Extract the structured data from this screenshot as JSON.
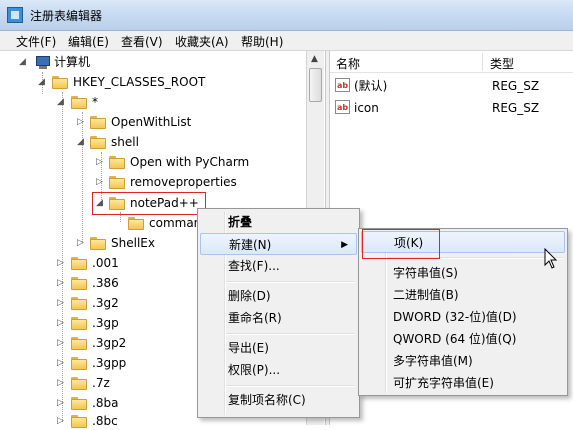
{
  "window": {
    "title": "注册表编辑器"
  },
  "menubar": [
    "文件(F)",
    "编辑(E)",
    "查看(V)",
    "收藏夹(A)",
    "帮助(H)"
  ],
  "tree": {
    "root": "计算机",
    "hkcr": "HKEY_CLASSES_ROOT",
    "star": "*",
    "openwithlist": "OpenWithList",
    "shell": "shell",
    "open_pycharm": "Open with PyCharm",
    "removeproperties": "removeproperties",
    "notepad": "notePad++",
    "command": "command",
    "shellex": "ShellEx",
    "extensions": [
      ".001",
      ".386",
      ".3g2",
      ".3gp",
      ".3gp2",
      ".3gpp",
      ".7z",
      ".8ba",
      ".8bc"
    ]
  },
  "list": {
    "headers": {
      "name": "名称",
      "type": "类型"
    },
    "rows": [
      {
        "name": "(默认)",
        "type": "REG_SZ"
      },
      {
        "name": "icon",
        "type": "REG_SZ"
      }
    ]
  },
  "context_menu": {
    "collapse": "折叠",
    "new": "新建(N)",
    "find": "查找(F)...",
    "delete": "删除(D)",
    "rename": "重命名(R)",
    "export": "导出(E)",
    "permissions": "权限(P)...",
    "copy_key_name": "复制项名称(C)"
  },
  "new_submenu": {
    "key": "项(K)",
    "string": "字符串值(S)",
    "binary": "二进制值(B)",
    "dword": "DWORD (32-位)值(D)",
    "qword": "QWORD (64 位)值(Q)",
    "multi_string": "多字符串值(M)",
    "expandable_string": "可扩充字符串值(E)"
  },
  "colors": {
    "highlight_border": "#e02424",
    "menu_bg": "#f0f0f0",
    "folder": "#f3c552"
  }
}
